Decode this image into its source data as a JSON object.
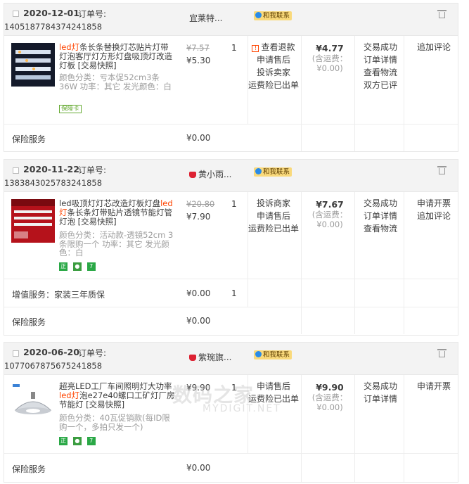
{
  "orders": [
    {
      "date": "2020-12-01",
      "order_label": "订单号:",
      "order_no": "1405187784374241858",
      "shop": "宜莱特...",
      "chat_label": "和我联系",
      "item": {
        "name_red": "led灯",
        "name_rest": "条长条替换灯芯贴片灯带灯泡客厅灯方形灯盘吸顶灯改造灯板 [交易快照]",
        "sku": "颜色分类：亏本促52cm3条36W  功率：其它  发光颜色：白",
        "guarantee_badge": "保障卡",
        "orig_price": "¥7.57",
        "price": "¥5.30",
        "qty": "1",
        "ops": [
          "查看退款",
          "申请售后",
          "投诉卖家",
          "运费险已出单"
        ],
        "total": "¥4.77",
        "shipping_note": "(含运费：¥0.00)",
        "status": [
          "交易成功",
          "订单详情",
          "查看物流",
          "双方已评"
        ],
        "actions": [
          "追加评论"
        ]
      },
      "services": [
        {
          "label": "保险服务",
          "price": "¥0.00",
          "qty": ""
        }
      ]
    },
    {
      "date": "2020-11-22",
      "order_label": "订单号:",
      "order_no": "1383843025783241858",
      "shop": "黄小雨...",
      "chat_label": "和我联系",
      "item": {
        "name_pre": "led吸顶灯灯芯改造灯板灯盘",
        "name_red": "led灯",
        "name_rest": "条长条灯带贴片透镜节能灯管灯泡 [交易快照]",
        "sku": "颜色分类：活动款-透镜52cm 3条限购一个  功率：其它  发光颜色：白",
        "badges": [
          "正",
          "💡",
          "7"
        ],
        "orig_price": "¥20.80",
        "price": "¥7.90",
        "qty": "1",
        "ops": [
          "投诉商家",
          "申请售后",
          "运费险已出单"
        ],
        "total": "¥7.67",
        "shipping_note": "(含运费：¥0.00)",
        "status": [
          "交易成功",
          "订单详情",
          "查看物流"
        ],
        "actions": [
          "申请开票",
          "追加评论"
        ]
      },
      "services": [
        {
          "label": "增值服务：家装三年质保",
          "price": "¥0.00",
          "qty": "1"
        },
        {
          "label": "保险服务",
          "price": "¥0.00",
          "qty": ""
        }
      ]
    },
    {
      "date": "2020-06-20",
      "order_label": "订单号:",
      "order_no": "1077067875675241858",
      "shop": "紫琬旗...",
      "chat_label": "和我联系",
      "item": {
        "name_pre": "超亮LED工厂车间照明灯大功率",
        "name_red": "led灯",
        "name_rest": "泡e27e40螺口工矿灯厂房节能灯 [交易快照]",
        "sku": "颜色分类：40瓦促销款(每ID限购一个，多拍只发一个)",
        "badges": [
          "正",
          "💡",
          "7"
        ],
        "orig_price": "",
        "price": "¥9.90",
        "qty": "1",
        "ops": [
          "申请售后",
          "运费险已出单"
        ],
        "total": "¥9.90",
        "shipping_note": "(含运费：¥0.00)",
        "status": [
          "交易成功",
          "订单详情"
        ],
        "actions": [
          "申请开票"
        ]
      },
      "services": [
        {
          "label": "保险服务",
          "price": "¥0.00",
          "qty": ""
        }
      ]
    }
  ],
  "watermark": {
    "line1": "数码之家",
    "line2": "MYDIGIT.NET"
  }
}
